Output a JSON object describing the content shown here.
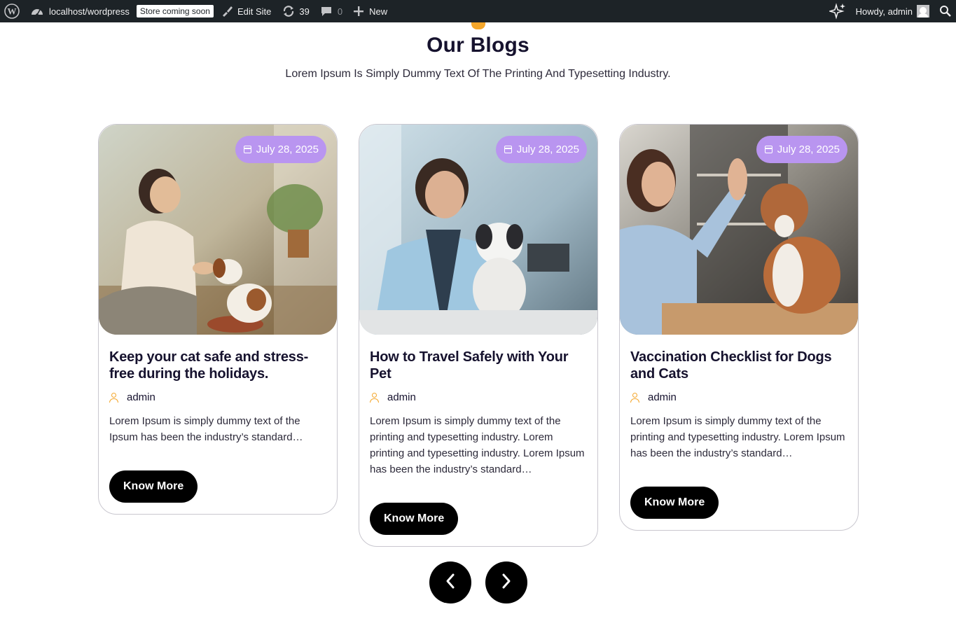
{
  "adminbar": {
    "site": "localhost/wordpress",
    "store_badge": "Store coming soon",
    "edit_site": "Edit Site",
    "updates": "39",
    "comments": "0",
    "new": "New",
    "howdy": "Howdy, admin"
  },
  "section": {
    "title": "Our Blogs",
    "subtitle": "Lorem Ipsum Is Simply Dummy Text Of The Printing And Typesetting Industry."
  },
  "cards": [
    {
      "date": "July 28, 2025",
      "title": "Keep your cat safe and stress-free during the holidays.",
      "author": "admin",
      "excerpt": "Lorem Ipsum is simply dummy text of the Ipsum has been the industry’s standard…",
      "button": "Know More"
    },
    {
      "date": "July 28, 2025",
      "title": "How to Travel Safely with Your Pet",
      "author": "admin",
      "excerpt": "Lorem Ipsum is simply dummy text of the printing and typesetting industry. Lorem printing and typesetting industry. Lorem Ipsum has been the industry’s standard…",
      "button": "Know More"
    },
    {
      "date": "July 28, 2025",
      "title": "Vaccination Checklist for Dogs and Cats",
      "author": "admin",
      "excerpt": "Lorem Ipsum is simply dummy text of the printing and typesetting industry. Lorem Ipsum has been the industry’s standard…",
      "button": "Know More"
    }
  ],
  "colors": {
    "accent_badge": "#b995f0",
    "accent_icon": "#f4a62a",
    "button": "#000000",
    "adminbar": "#1d2327"
  },
  "icons": {
    "wp": "wordpress-logo-icon",
    "site": "dashboard-icon",
    "edit": "brush-icon",
    "updates": "refresh-icon",
    "comments": "comment-icon",
    "new": "plus-icon",
    "ai": "sparkle-icon",
    "search": "search-icon",
    "date": "calendar-icon",
    "author": "user-icon",
    "prev": "chevron-left-icon",
    "next": "chevron-right-icon"
  }
}
